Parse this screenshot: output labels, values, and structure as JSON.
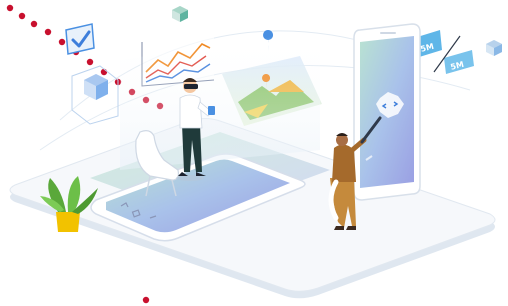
{
  "scene": {
    "chips": [
      {
        "label": "5M"
      },
      {
        "label": "5M"
      }
    ]
  },
  "colors": {
    "accent_dot": "#c8102e",
    "platform": "#eef3f8",
    "platform_edge": "#d8e2ec",
    "phone_screen": "#8ea6e0",
    "tablet_screen": "#dff0d8",
    "icon_blue": "#4a90e2",
    "chart_orange": "#f08a24",
    "chart_red": "#e0463c",
    "chart_blue": "#3d7edb",
    "plant_green": "#5aa83a",
    "pot_yellow": "#f2c200"
  },
  "icons": [
    "checkmark-icon",
    "cube-icon",
    "line-chart-icon",
    "map-pin-icon",
    "mountain-landscape-icon",
    "code-icon",
    "sim-card-icon"
  ]
}
